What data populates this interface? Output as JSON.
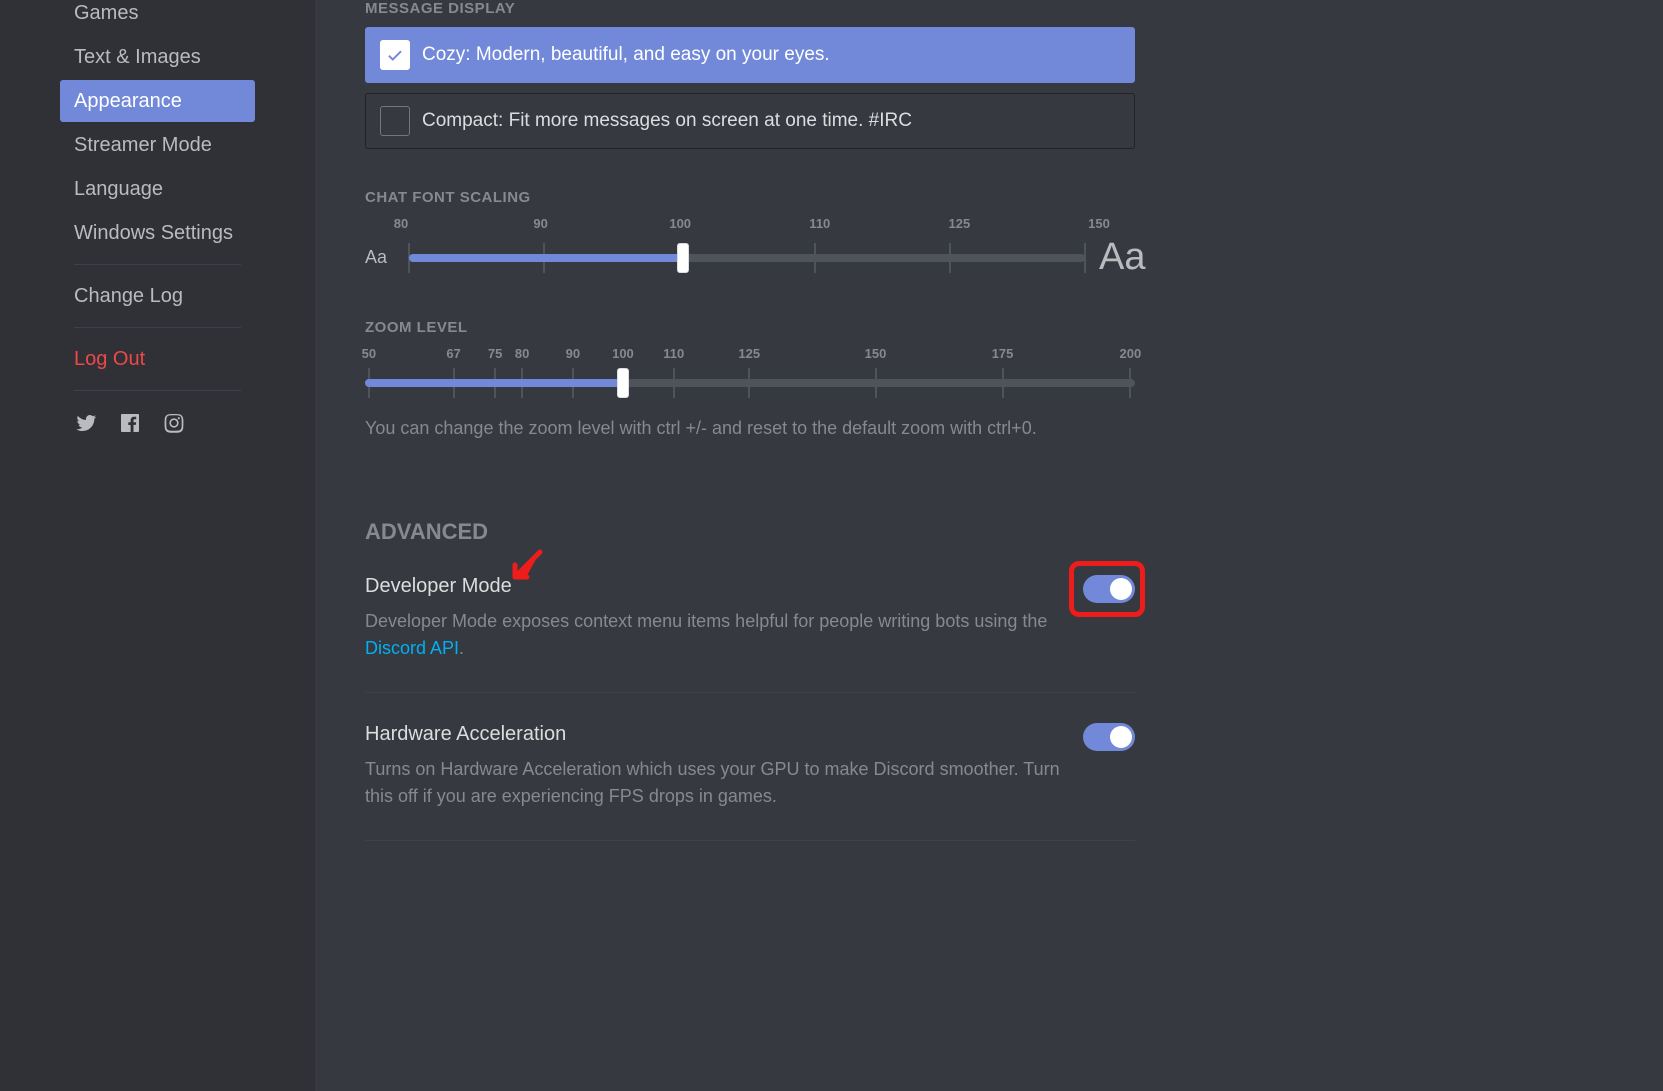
{
  "sidebar": {
    "items": [
      {
        "label": "Games",
        "partial": true
      },
      {
        "label": "Text & Images"
      },
      {
        "label": "Appearance",
        "active": true
      },
      {
        "label": "Streamer Mode"
      },
      {
        "label": "Language"
      },
      {
        "label": "Windows Settings"
      }
    ],
    "change_log": "Change Log",
    "log_out": "Log Out"
  },
  "message_display": {
    "header": "MESSAGE DISPLAY",
    "cozy": "Cozy: Modern, beautiful, and easy on your eyes.",
    "compact": "Compact: Fit more messages on screen at one time. #IRC"
  },
  "font_scaling": {
    "header": "CHAT FONT SCALING",
    "ticks": [
      "80",
      "90",
      "100",
      "110",
      "125",
      "150"
    ],
    "value_pct": 40.5,
    "aa": "Aa"
  },
  "zoom": {
    "header": "ZOOM LEVEL",
    "ticks": [
      {
        "label": "50",
        "pct": 0.5
      },
      {
        "label": "67",
        "pct": 11.5
      },
      {
        "label": "75",
        "pct": 16.9
      },
      {
        "label": "80",
        "pct": 20.4
      },
      {
        "label": "90",
        "pct": 27
      },
      {
        "label": "100",
        "pct": 33.5
      },
      {
        "label": "110",
        "pct": 40.1
      },
      {
        "label": "125",
        "pct": 49.9
      },
      {
        "label": "150",
        "pct": 66.3
      },
      {
        "label": "175",
        "pct": 82.8
      },
      {
        "label": "200",
        "pct": 99.4
      }
    ],
    "value_pct": 33.5,
    "help": "You can change the zoom level with ctrl +/- and reset to the default zoom with ctrl+0."
  },
  "advanced": {
    "header": "ADVANCED",
    "dev_mode": {
      "title": "Developer Mode",
      "desc_pre": "Developer Mode exposes context menu items helpful for people writing bots using the ",
      "desc_link": "Discord API",
      "desc_post": ".",
      "on": true
    },
    "hw_accel": {
      "title": "Hardware Acceleration",
      "desc": "Turns on Hardware Acceleration which uses your GPU to make Discord smoother. Turn this off if you are experiencing FPS drops in games.",
      "on": true
    }
  }
}
